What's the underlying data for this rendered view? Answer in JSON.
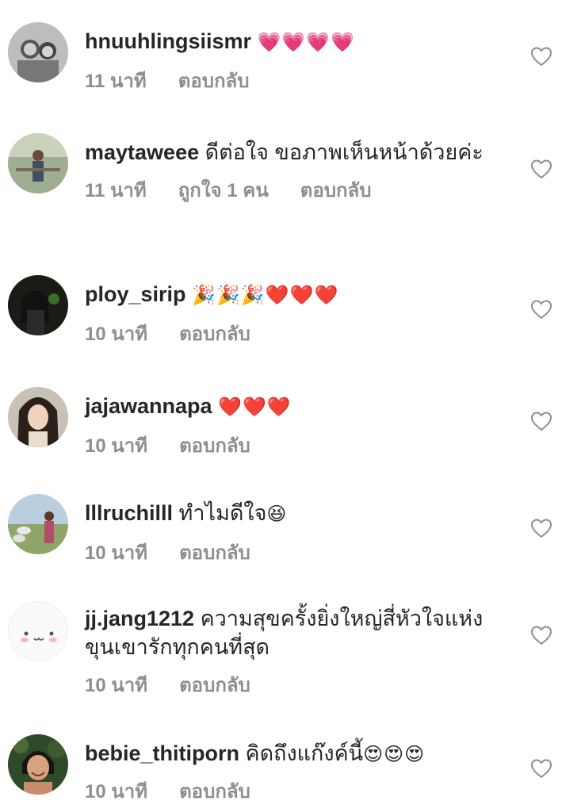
{
  "comments": [
    {
      "username": "hnuuhlingsiismr",
      "text": "",
      "emojis": "💗💗💗💗",
      "time": "11 นาที",
      "likes": "",
      "reply": "ตอบกลับ",
      "avatar": "avatar-bw-two-people"
    },
    {
      "username": "maytaweee",
      "text": "ดีต่อใจ ขอภาพเห็นหน้าด้วยค่ะ",
      "emojis": "",
      "time": "11 นาที",
      "likes": "ถูกใจ 1 คน",
      "reply": "ตอบกลับ",
      "avatar": "avatar-outdoor-woman"
    },
    {
      "username": "ploy_sirip",
      "text": "",
      "emojis": "🎉🎉🎉❤️❤️❤️",
      "time": "10 นาที",
      "likes": "",
      "reply": "ตอบกลับ",
      "avatar": "avatar-dark-woman"
    },
    {
      "username": "jajawannapa",
      "text": "",
      "emojis": "❤️❤️❤️",
      "time": "10 นาที",
      "likes": "",
      "reply": "ตอบกลับ",
      "avatar": "avatar-woman-portrait"
    },
    {
      "username": "lllruchilll",
      "text": "ทำไมดีใจ",
      "emojis": "😆",
      "time": "10 นาที",
      "likes": "",
      "reply": "ตอบกลับ",
      "avatar": "avatar-field-woman"
    },
    {
      "username": "jj.jang1212",
      "text": "ความสุขครั้งยิ่งใหญ่สี่หัวใจแห่งขุนเขารักทุกคนที่สุด",
      "emojis": "",
      "time": "10 นาที",
      "likes": "",
      "reply": "ตอบกลับ",
      "avatar": "avatar-cartoon-face"
    },
    {
      "username": "bebie_thitiporn",
      "text": "คิดถึงแก๊งค์นี้",
      "emojis": "😍😍😍",
      "time": "10 นาที",
      "likes": "",
      "reply": "ตอบกลับ",
      "avatar": "avatar-smiling-woman"
    }
  ],
  "icons": {
    "like": "heart-outline-icon"
  },
  "colors": {
    "text": "#262626",
    "meta": "#8e8e8e"
  }
}
